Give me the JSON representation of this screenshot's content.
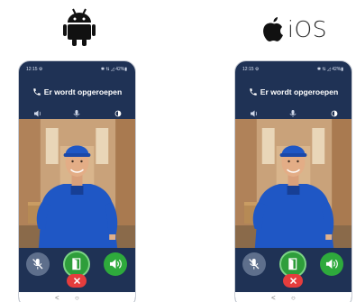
{
  "platforms": {
    "android": {
      "icon": "android-robot-icon"
    },
    "ios": {
      "icon": "apple-logo-icon",
      "label": "iOS"
    }
  },
  "phones": [
    {
      "status": {
        "time": "12:15 ⚙",
        "icons": "✱ ⇅ ◿ 42%▮"
      },
      "call_title": "Er wordt opgeroepen",
      "controls": {
        "volume": "◀)",
        "mic": "🎤",
        "brightness": "◑"
      },
      "actions": [
        "mute-mic-icon",
        "door-open-icon",
        "speaker-icon",
        "hangup-icon"
      ],
      "nav": [
        "<",
        "○"
      ]
    },
    {
      "status": {
        "time": "12:15 ⚙",
        "icons": "✱ ⇅ ◿ 42%▮"
      },
      "call_title": "Er wordt opgeroepen",
      "controls": {
        "volume": "◀)",
        "mic": "🎤",
        "brightness": "◑"
      },
      "actions": [
        "mute-mic-icon",
        "door-open-icon",
        "speaker-icon",
        "hangup-icon"
      ],
      "nav": [
        "<",
        "○"
      ]
    }
  ],
  "colors": {
    "header_bg": "#1f3255",
    "open_green": "#2e9e3b",
    "hangup_red": "#e53d3d",
    "mute_grey": "#5e6f8c"
  }
}
